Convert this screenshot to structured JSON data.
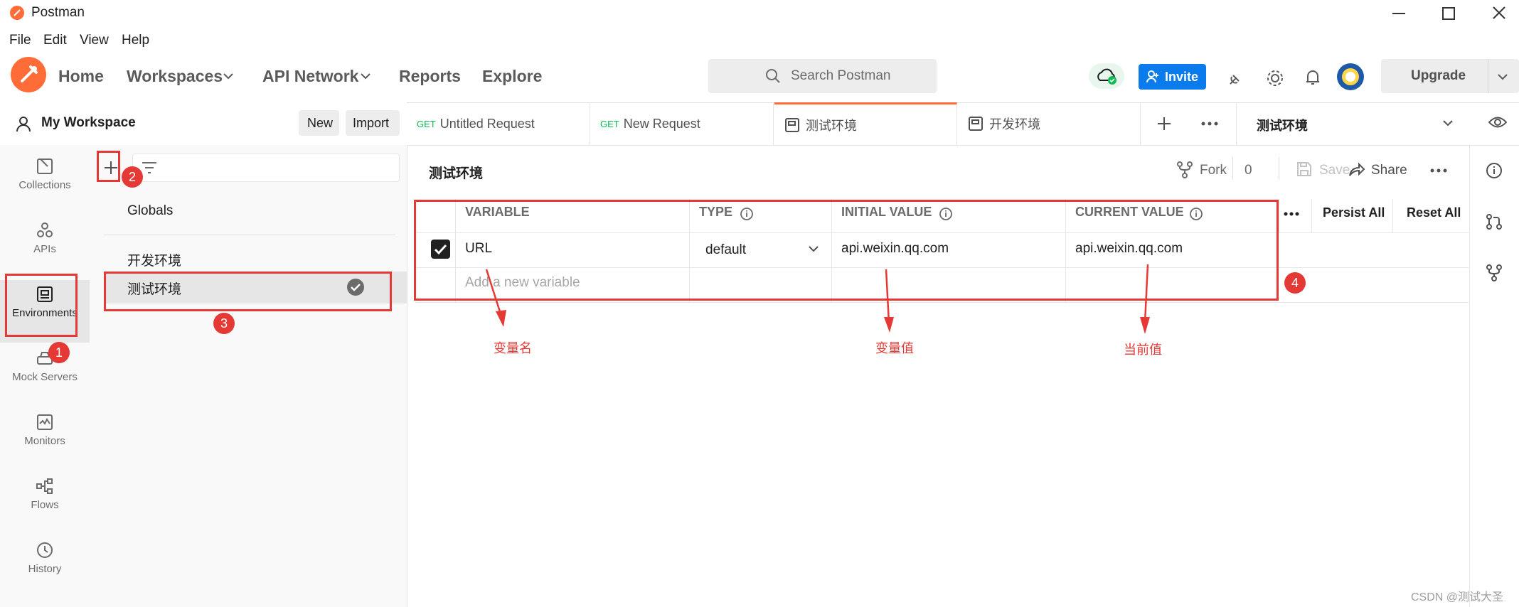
{
  "app": {
    "title": "Postman"
  },
  "menu": [
    "File",
    "Edit",
    "View",
    "Help"
  ],
  "header": {
    "nav": {
      "home": "Home",
      "workspaces": "Workspaces",
      "api_network": "API Network",
      "reports": "Reports",
      "explore": "Explore"
    },
    "search_placeholder": "Search Postman",
    "invite_label": "Invite",
    "upgrade_label": "Upgrade"
  },
  "workspace": {
    "name": "My Workspace",
    "new_label": "New",
    "import_label": "Import"
  },
  "rail": {
    "collections": "Collections",
    "apis": "APIs",
    "environments": "Environments",
    "mock_servers": "Mock Servers",
    "monitors": "Monitors",
    "flows": "Flows",
    "history": "History"
  },
  "env_list": {
    "globals": "Globals",
    "items": [
      "开发环境",
      "测试环境"
    ]
  },
  "tabs": [
    {
      "method": "GET",
      "label": "Untitled Request"
    },
    {
      "method": "GET",
      "label": "New Request"
    },
    {
      "method": "",
      "label": "测试环境"
    },
    {
      "method": "",
      "label": "开发环境"
    }
  ],
  "env_selector": "测试环境",
  "editor": {
    "title": "测试环境",
    "fork_label": "Fork",
    "fork_count": "0",
    "save_label": "Save",
    "share_label": "Share",
    "persist_all_label": "Persist All",
    "reset_all_label": "Reset All",
    "columns": {
      "variable": "VARIABLE",
      "type": "TYPE",
      "initial_value": "INITIAL VALUE",
      "current_value": "CURRENT VALUE"
    },
    "row": {
      "variable": "URL",
      "type": "default",
      "initial_value": "api.weixin.qq.com",
      "current_value": "api.weixin.qq.com"
    },
    "add_placeholder": "Add a new variable"
  },
  "annotations": {
    "badges": [
      "1",
      "2",
      "3",
      "4"
    ],
    "variable_name": "变量名",
    "variable_value": "变量值",
    "current_value": "当前值"
  },
  "watermark": "CSDN @测试大圣",
  "colors": {
    "brand_orange": "#ff6c37",
    "invite_blue": "#097bed",
    "annotation_red": "#e53935",
    "get_green": "#0cbb52"
  }
}
